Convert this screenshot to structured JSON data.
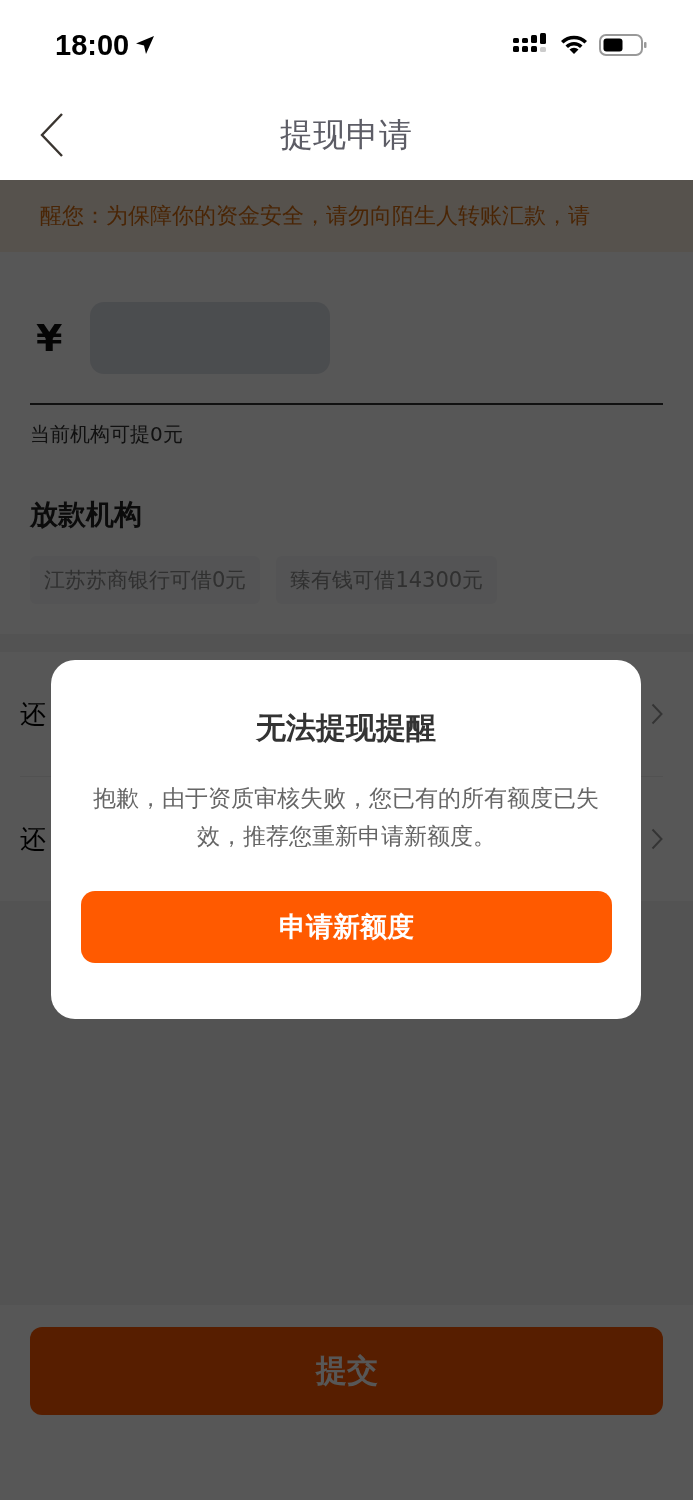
{
  "status_bar": {
    "time": "18:00"
  },
  "nav": {
    "title": "提现申请"
  },
  "notice": {
    "text": "醒您：为保障你的资金安全，请勿向陌生人转账汇款，请"
  },
  "amount": {
    "currency": "¥",
    "available": "当前机构可提0元"
  },
  "lenders": {
    "heading": "放款机构",
    "options": [
      {
        "label": "江苏苏商银行可借0元",
        "disabled": true
      },
      {
        "label": "臻有钱可借14300元",
        "disabled": true
      }
    ]
  },
  "rows": [
    {
      "label": "还"
    },
    {
      "label": "还"
    }
  ],
  "submit": {
    "label": "提交"
  },
  "dialog": {
    "title": "无法提现提醒",
    "message": "抱歉，由于资质审核失败，您已有的所有额度已失效，推荐您重新申请新额度。",
    "button": "申请新额度"
  }
}
